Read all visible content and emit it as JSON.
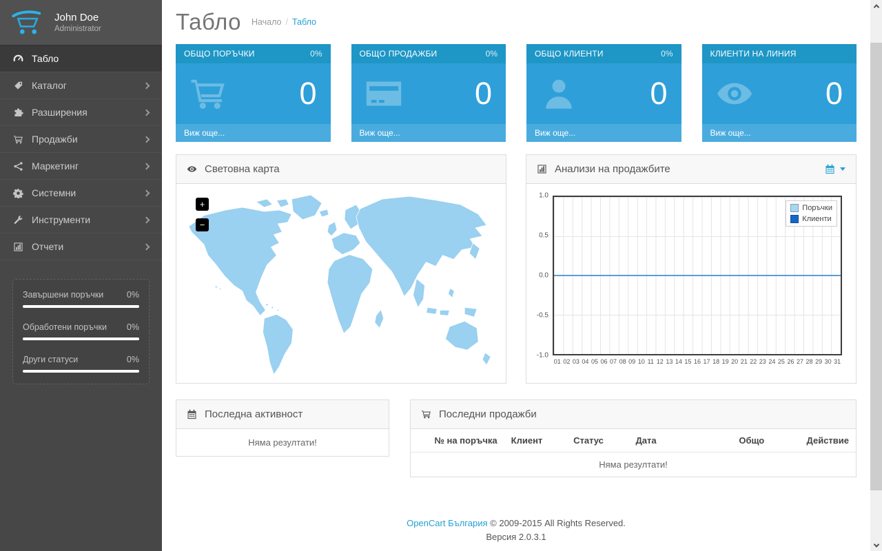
{
  "user": {
    "name": "John Doe",
    "role": "Administrator"
  },
  "header": {
    "title": "Табло",
    "breadcrumb": [
      "Начало",
      "Табло"
    ],
    "breadcrumb_separator": "/"
  },
  "sidebar": {
    "items": [
      {
        "id": "dashboard",
        "label": "Табло",
        "icon": "dashboard-icon",
        "active": true,
        "has_submenu": false
      },
      {
        "id": "catalog",
        "label": "Каталог",
        "icon": "tag-icon",
        "active": false,
        "has_submenu": true
      },
      {
        "id": "extensions",
        "label": "Разширения",
        "icon": "puzzle-icon",
        "active": false,
        "has_submenu": true
      },
      {
        "id": "sales",
        "label": "Продажби",
        "icon": "cart-icon",
        "active": false,
        "has_submenu": true
      },
      {
        "id": "marketing",
        "label": "Маркетинг",
        "icon": "share-icon",
        "active": false,
        "has_submenu": true
      },
      {
        "id": "system",
        "label": "Системни",
        "icon": "gear-icon",
        "active": false,
        "has_submenu": true
      },
      {
        "id": "tools",
        "label": "Инструменти",
        "icon": "wrench-icon",
        "active": false,
        "has_submenu": true
      },
      {
        "id": "reports",
        "label": "Отчети",
        "icon": "chart-icon",
        "active": false,
        "has_submenu": true
      }
    ],
    "stats": [
      {
        "label": "Завършени поръчки",
        "value": "0%",
        "percent": 0
      },
      {
        "label": "Обработени поръчки",
        "value": "0%",
        "percent": 0
      },
      {
        "label": "Други статуси",
        "value": "0%",
        "percent": 0
      }
    ]
  },
  "tiles": [
    {
      "id": "orders-total",
      "title": "ОБЩО ПОРЪЧКИ",
      "percent": "0%",
      "value": "0",
      "footer": "Виж още...",
      "icon": "cart-icon"
    },
    {
      "id": "sales-total",
      "title": "ОБЩО ПРОДАЖБИ",
      "percent": "0%",
      "value": "0",
      "footer": "Виж още...",
      "icon": "credit-card-icon"
    },
    {
      "id": "customers-total",
      "title": "ОБЩО КЛИЕНТИ",
      "percent": "0%",
      "value": "0",
      "footer": "Виж още...",
      "icon": "user-icon"
    },
    {
      "id": "customers-online",
      "title": "КЛИЕНТИ НА ЛИНИЯ",
      "percent": "",
      "value": "0",
      "footer": "Виж още...",
      "icon": "eye-icon"
    }
  ],
  "map_panel": {
    "title": "Световна карта",
    "zoom_in": "+",
    "zoom_out": "−"
  },
  "chart_panel": {
    "title": "Анализи на продажбите"
  },
  "chart_data": {
    "type": "line",
    "title": "Анализи на продажбите",
    "x": [
      "01",
      "02",
      "03",
      "04",
      "05",
      "06",
      "07",
      "08",
      "09",
      "10",
      "11",
      "12",
      "13",
      "14",
      "15",
      "16",
      "17",
      "18",
      "19",
      "20",
      "21",
      "22",
      "23",
      "24",
      "25",
      "26",
      "27",
      "28",
      "29",
      "30",
      "31"
    ],
    "xlabel": "",
    "ylabel": "",
    "ylim": [
      -1,
      1
    ],
    "yticks": [
      "1.0",
      "0.5",
      "0.0",
      "-0.5",
      "-1.0"
    ],
    "grid": true,
    "legend_position": "top-right",
    "series": [
      {
        "name": "Поръчки",
        "color": "#A9D5F0",
        "values": [
          0,
          0,
          0,
          0,
          0,
          0,
          0,
          0,
          0,
          0,
          0,
          0,
          0,
          0,
          0,
          0,
          0,
          0,
          0,
          0,
          0,
          0,
          0,
          0,
          0,
          0,
          0,
          0,
          0,
          0,
          0
        ]
      },
      {
        "name": "Клиенти",
        "color": "#1566C8",
        "values": [
          0,
          0,
          0,
          0,
          0,
          0,
          0,
          0,
          0,
          0,
          0,
          0,
          0,
          0,
          0,
          0,
          0,
          0,
          0,
          0,
          0,
          0,
          0,
          0,
          0,
          0,
          0,
          0,
          0,
          0,
          0
        ]
      }
    ]
  },
  "activity_panel": {
    "title": "Последна активност",
    "empty": "Няма резултати!"
  },
  "orders_panel": {
    "title": "Последни продажби",
    "columns": [
      "№ на поръчка",
      "Клиент",
      "Статус",
      "Дата",
      "Общо",
      "Действие"
    ],
    "empty": "Няма резултати!"
  },
  "footer": {
    "link": "OpenCart България",
    "copyright": "© 2009-2015 All Rights Reserved.",
    "version": "Версия 2.0.3.1"
  },
  "colors": {
    "accent_blue": "#23A1D1",
    "tile_header": "#1E96C6",
    "tile_body": "#2F9FD9",
    "tile_footer": "#4AACDE",
    "map_fill": "#9AD0F0",
    "sidebar_bg": "#474747"
  }
}
